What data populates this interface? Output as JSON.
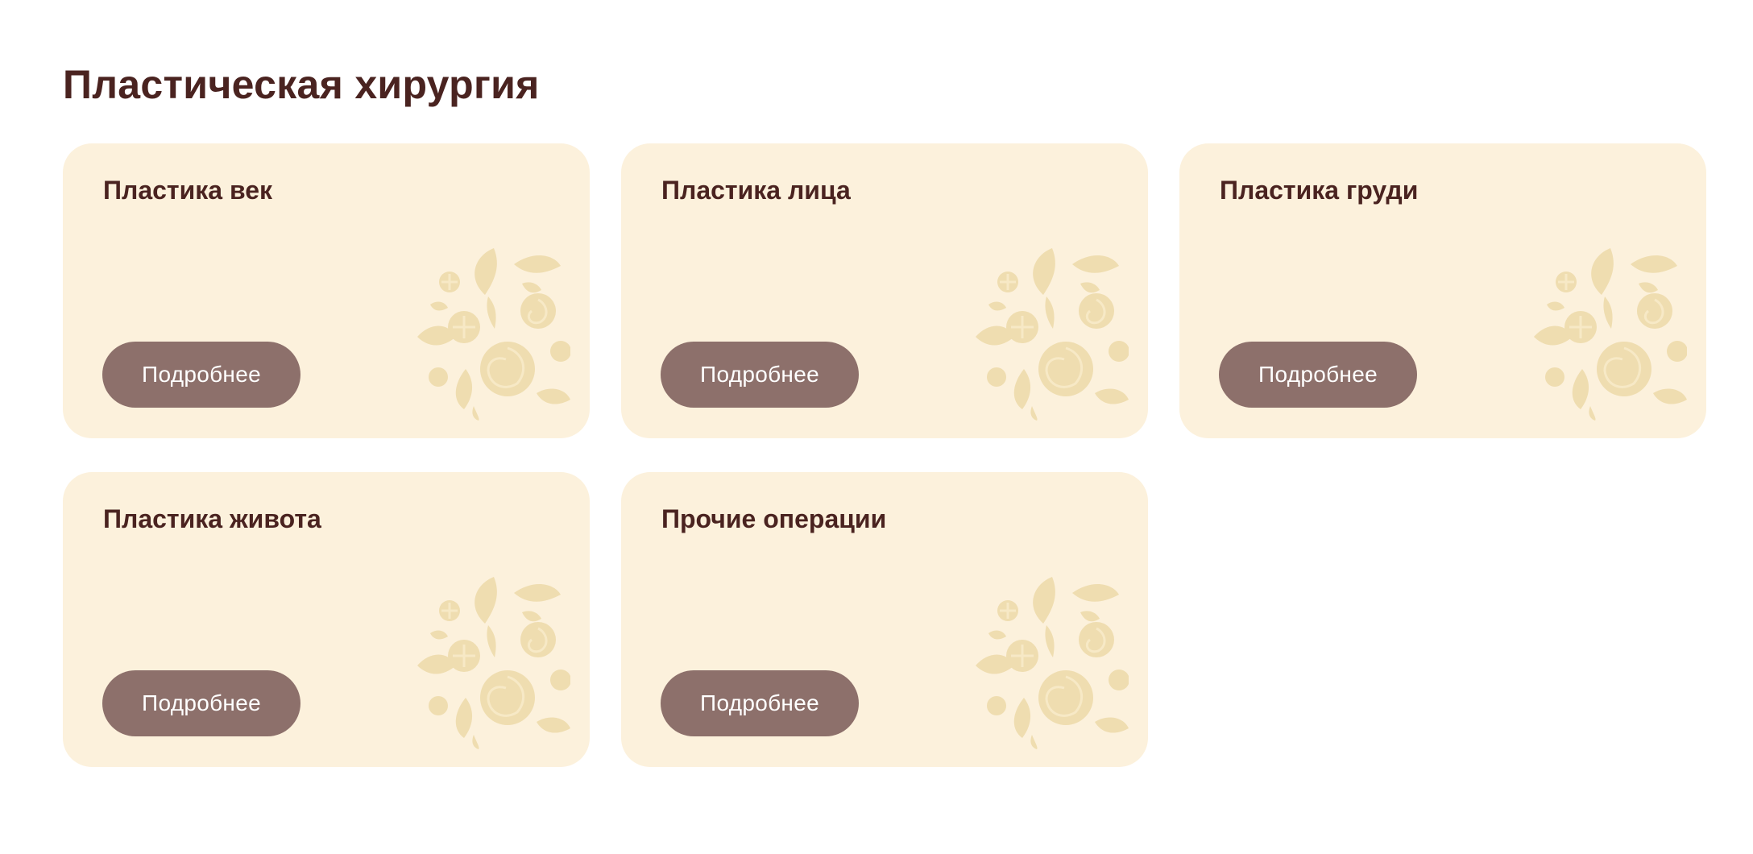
{
  "section": {
    "title": "Пластическая хирургия"
  },
  "colors": {
    "title": "#4a2320",
    "card_background": "#fcf1dc",
    "button_background": "#8d706b",
    "button_text": "#ffffff",
    "ornament": "#efddb0"
  },
  "cards": [
    {
      "title": "Пластика век",
      "button_label": "Подробнее",
      "icon": "floral-ornament-icon"
    },
    {
      "title": "Пластика лица",
      "button_label": "Подробнее",
      "icon": "floral-ornament-icon"
    },
    {
      "title": "Пластика груди",
      "button_label": "Подробнее",
      "icon": "floral-ornament-icon"
    },
    {
      "title": "Пластика живота",
      "button_label": "Подробнее",
      "icon": "floral-ornament-icon"
    },
    {
      "title": "Прочие операции",
      "button_label": "Подробнее",
      "icon": "floral-ornament-icon"
    }
  ]
}
